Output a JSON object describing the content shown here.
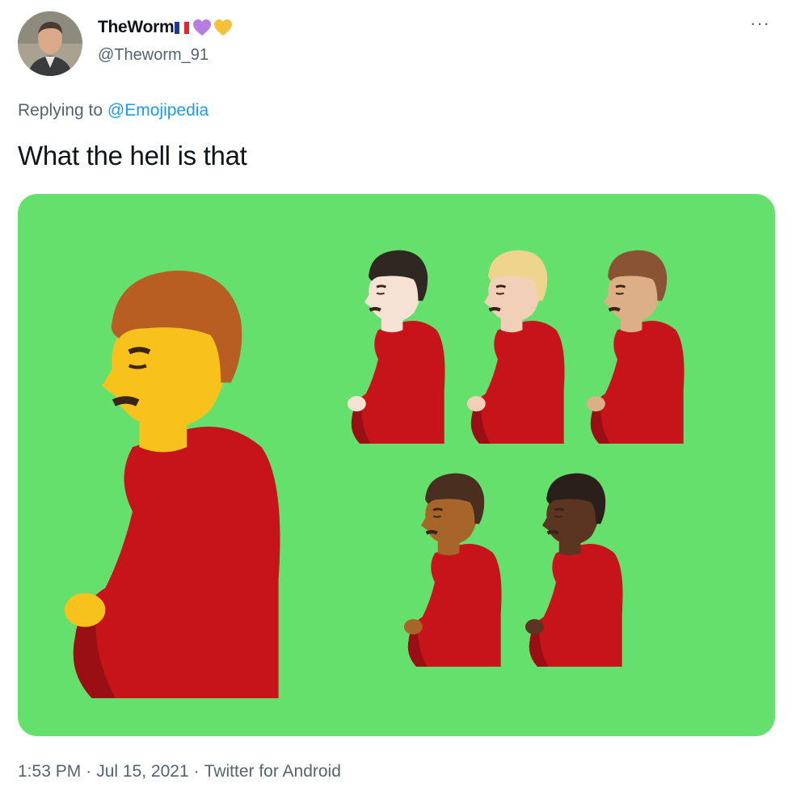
{
  "tweet": {
    "display_name": "TheWorm",
    "name_emojis": [
      "french-flag-emoji",
      "purple-heart-emoji",
      "yellow-heart-emoji"
    ],
    "handle": "@Theworm_91",
    "more_label": "···",
    "replying_prefix": "Replying to",
    "replying_to": "@Emojipedia",
    "text": "What the hell is that",
    "time": "1:53 PM",
    "date": "Jul 15, 2021",
    "source": "Twitter for Android",
    "separator": "·"
  },
  "media": {
    "description_icon": "pregnant-man-emoji-set",
    "background": "#66e06d",
    "figures": [
      {
        "name": "pregnant-man-default",
        "skin": "#f7c21c",
        "hair": "#b85e22"
      },
      {
        "name": "pregnant-man-light",
        "skin": "#f6e2d4",
        "hair": "#2f2722"
      },
      {
        "name": "pregnant-man-medium-light",
        "skin": "#f2d0b8",
        "hair": "#efd48d"
      },
      {
        "name": "pregnant-man-medium",
        "skin": "#dcaf86",
        "hair": "#8a5434"
      },
      {
        "name": "pregnant-man-medium-dark",
        "skin": "#a8652a",
        "hair": "#4a2e20"
      },
      {
        "name": "pregnant-man-dark",
        "skin": "#5b3422",
        "hair": "#2b1f1b"
      }
    ]
  },
  "colors": {
    "name": "#0f1419",
    "secondary": "#536471",
    "link": "#1d9bf0",
    "shirt": "#c6141a",
    "shirt_shadow": "#9a0f14"
  }
}
